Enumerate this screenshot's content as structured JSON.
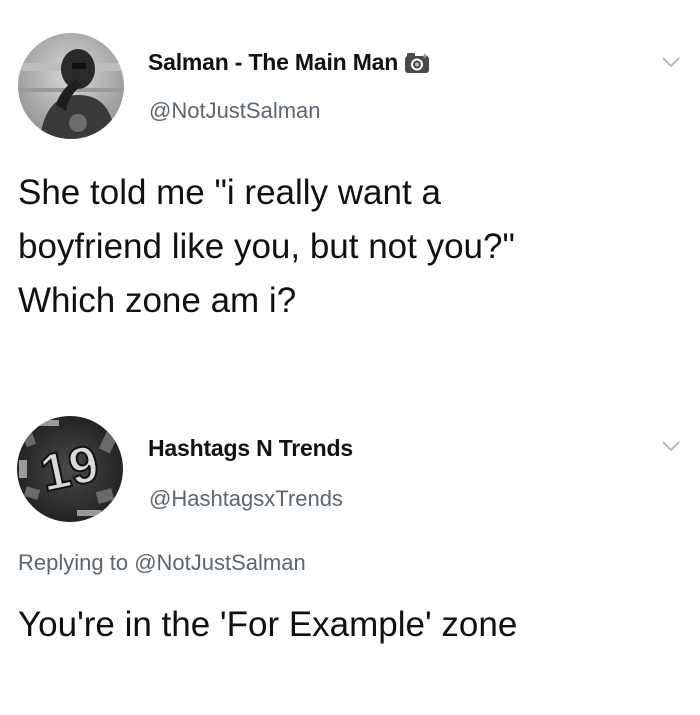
{
  "tweets": [
    {
      "author_name": "Salman - The Main Man",
      "handle": "@NotJustSalman",
      "badge_icon": "camera-emoji-icon",
      "text_lines": [
        "She told me \"i really want a",
        "boyfriend like you, but not you?\"",
        "Which zone am i?"
      ]
    },
    {
      "author_name": "Hashtags N Trends",
      "handle": "@HashtagsxTrends",
      "avatar_label": "19",
      "reply_prefix": "Replying to",
      "reply_mention": "@NotJustSalman",
      "text": "You're in the 'For Example' zone"
    }
  ],
  "colors": {
    "text": "#101010",
    "secondary": "#5b6670",
    "background": "#ffffff"
  }
}
